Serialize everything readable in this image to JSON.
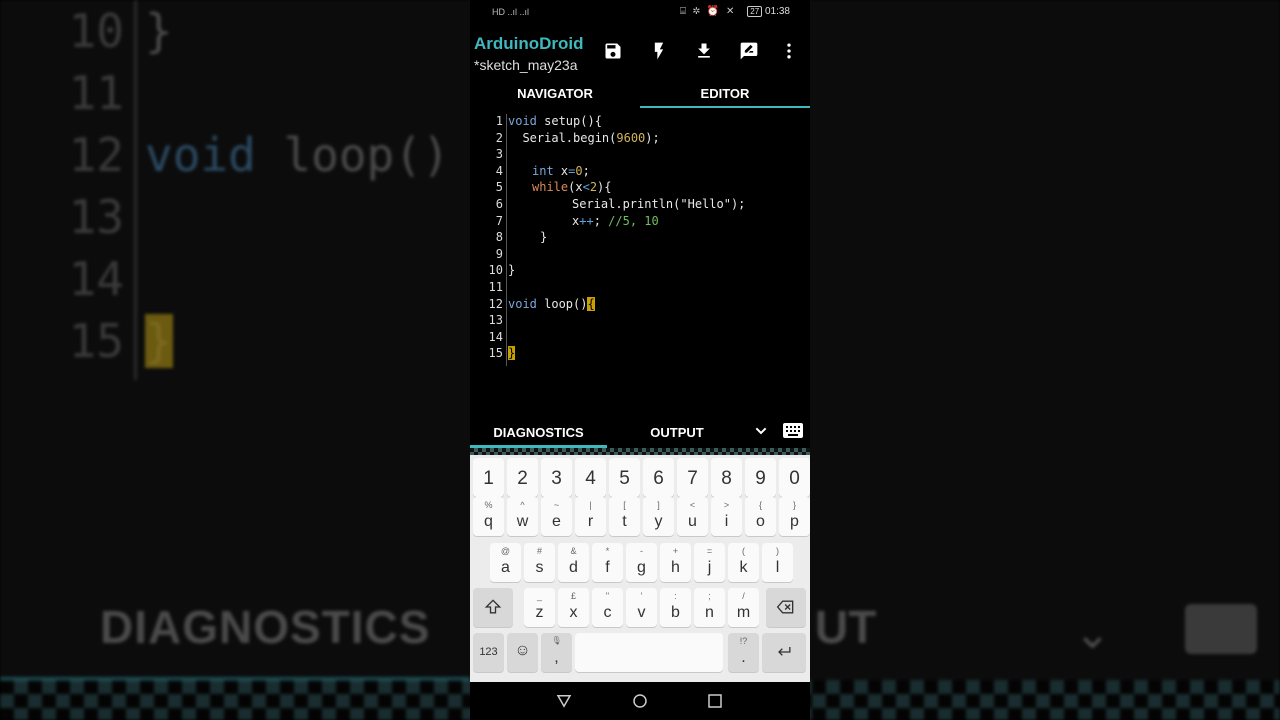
{
  "background": {
    "lines": [
      {
        "num": "10",
        "code": "}"
      },
      {
        "num": "11",
        "code": ""
      },
      {
        "num": "12",
        "code_kw": "void",
        "code_rest": " loop()"
      },
      {
        "num": "13",
        "code": ""
      },
      {
        "num": "14",
        "code": ""
      },
      {
        "num": "15",
        "code_hl": "}"
      }
    ],
    "diagnostics": "DIAGNOSTICS",
    "output_fragment": "UT"
  },
  "status_bar": {
    "left": "HD ..ıl ..ıl",
    "battery": "27",
    "time": "01:38"
  },
  "app_bar": {
    "title": "ArduinoDroid",
    "subtitle": "*sketch_may23a",
    "icons": [
      "save-icon",
      "flash-icon",
      "download-icon",
      "edit-icon",
      "more-vert-icon"
    ]
  },
  "tabs": {
    "navigator": "NAVIGATOR",
    "editor": "EDITOR",
    "active": "editor"
  },
  "editor": {
    "lines": [
      {
        "n": "1"
      },
      {
        "n": "2"
      },
      {
        "n": "3"
      },
      {
        "n": "4"
      },
      {
        "n": "5"
      },
      {
        "n": "6"
      },
      {
        "n": "7"
      },
      {
        "n": "8"
      },
      {
        "n": "9"
      },
      {
        "n": "10"
      },
      {
        "n": "11"
      },
      {
        "n": "12"
      },
      {
        "n": "13"
      },
      {
        "n": "14"
      },
      {
        "n": "15"
      }
    ],
    "tokens": {
      "l1_kw": "void",
      "l1_rest": " setup(){",
      "l2_a": "  Serial.begin(",
      "l2_num": "9600",
      "l2_b": ");",
      "l4_kw": "int",
      "l4_a": " x",
      "l4_op": "=",
      "l4_num": "0",
      "l4_b": ";",
      "l5_kw": "while",
      "l5_a": "(x",
      "l5_op": "<",
      "l5_num": "2",
      "l5_b": "){",
      "l6": "Serial.println(\"Hello\");",
      "l7_a": "x",
      "l7_op": "++",
      "l7_b": "; ",
      "l7_cm": "//5, 10",
      "l8": "}",
      "l10": "}",
      "l12_kw": "void",
      "l12_rest": " loop()",
      "l12_hl": "{",
      "l15_hl": "}"
    }
  },
  "bottom_panel": {
    "diagnostics": "DIAGNOSTICS",
    "output": "OUTPUT",
    "active": "diagnostics"
  },
  "keyboard": {
    "numbers": [
      "1",
      "2",
      "3",
      "4",
      "5",
      "6",
      "7",
      "8",
      "9",
      "0"
    ],
    "row1": [
      {
        "alt": "%",
        "main": "q"
      },
      {
        "alt": "^",
        "main": "w"
      },
      {
        "alt": "~",
        "main": "e"
      },
      {
        "alt": "|",
        "main": "r"
      },
      {
        "alt": "[",
        "main": "t"
      },
      {
        "alt": "]",
        "main": "y"
      },
      {
        "alt": "<",
        "main": "u"
      },
      {
        "alt": ">",
        "main": "i"
      },
      {
        "alt": "{",
        "main": "o"
      },
      {
        "alt": "}",
        "main": "p"
      }
    ],
    "row2": [
      {
        "alt": "@",
        "main": "a"
      },
      {
        "alt": "#",
        "main": "s"
      },
      {
        "alt": "&",
        "main": "d"
      },
      {
        "alt": "*",
        "main": "f"
      },
      {
        "alt": "-",
        "main": "g"
      },
      {
        "alt": "+",
        "main": "h"
      },
      {
        "alt": "=",
        "main": "j"
      },
      {
        "alt": "(",
        "main": "k"
      },
      {
        "alt": ")",
        "main": "l"
      }
    ],
    "row3": [
      {
        "alt": "_",
        "main": "z"
      },
      {
        "alt": "£",
        "main": "x"
      },
      {
        "alt": "\"",
        "main": "c"
      },
      {
        "alt": "'",
        "main": "v"
      },
      {
        "alt": ":",
        "main": "b"
      },
      {
        "alt": ";",
        "main": "n"
      },
      {
        "alt": "/",
        "main": "m"
      }
    ],
    "key_123": "123",
    "comma": ",",
    "period": ".",
    "period_alt": "!?",
    "comma_alt": "🎤"
  },
  "nav_bar": {
    "icons": [
      "back-icon",
      "home-icon",
      "recents-icon"
    ]
  }
}
